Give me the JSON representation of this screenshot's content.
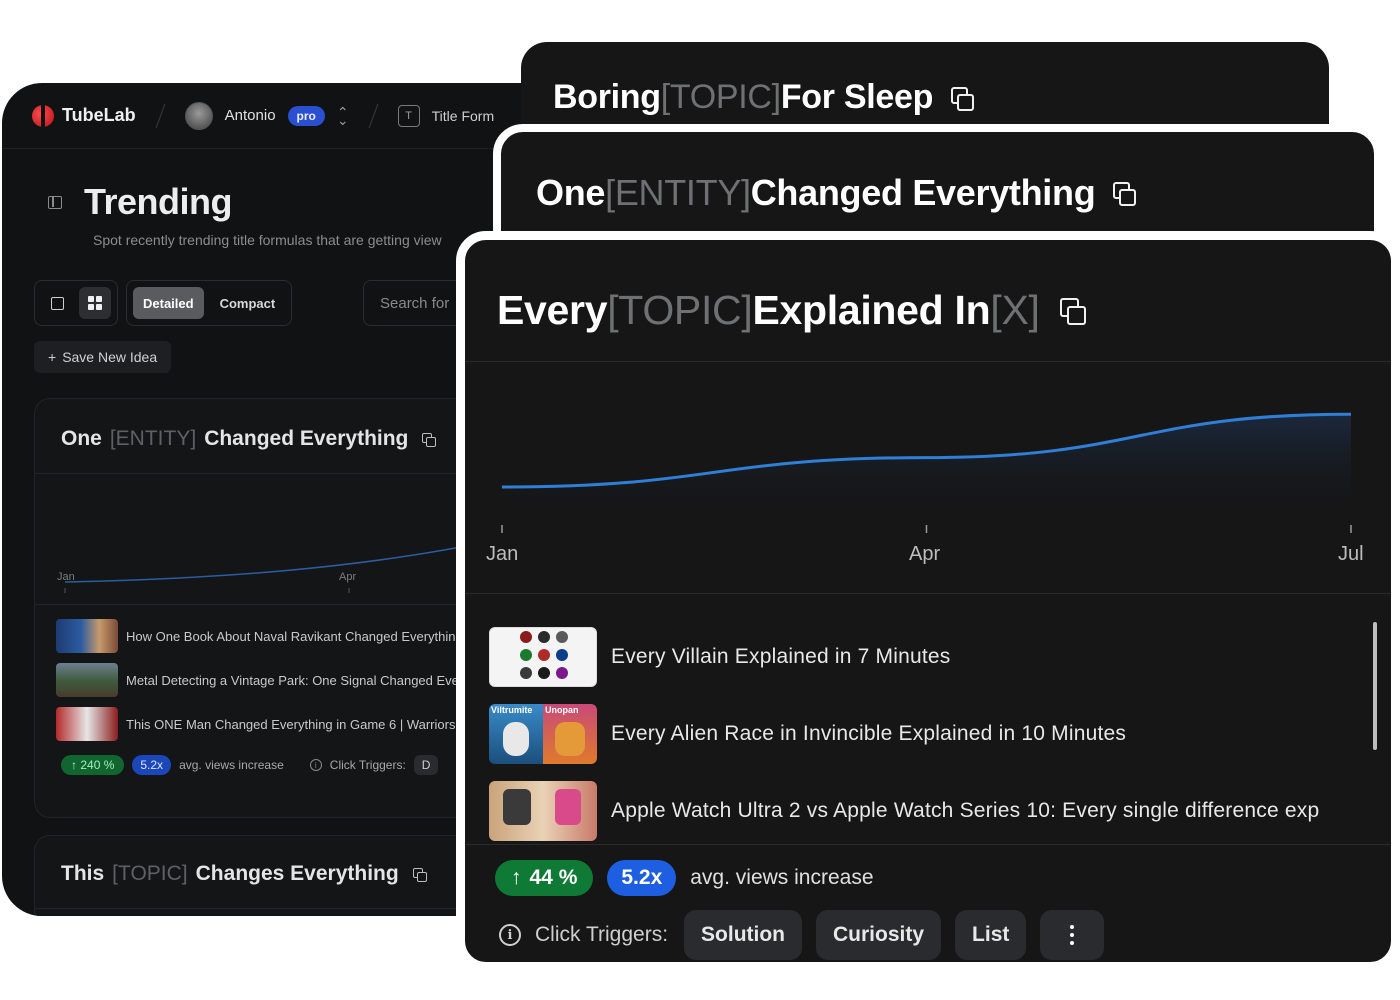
{
  "app": {
    "brand": "TubeLab",
    "user_name": "Antonio",
    "plan_badge": "pro",
    "section_label": "Title Form",
    "page_title": "Trending",
    "page_subtitle": "Spot recently trending title formulas that are getting view",
    "view_modes": [
      "Detailed",
      "Compact"
    ],
    "active_view_mode": "Detailed",
    "search_placeholder": "Search for",
    "save_idea_label": "Save New Idea",
    "card1": {
      "title_parts": [
        "One ",
        "[ENTITY]",
        " Changed Everything"
      ],
      "x_ticks": [
        "Jan",
        "Apr"
      ],
      "videos": [
        "How One Book About Naval Ravikant Changed Everythin",
        "Metal Detecting a Vintage Park: One Signal Changed Eve",
        "This ONE Man Changed Everything in Game 6 | Warriors"
      ],
      "growth": "240 %",
      "multiplier": "5.2x",
      "stat_text": "avg. views increase",
      "click_triggers_label": "Click Triggers:",
      "trigger_fragment": "D"
    },
    "card2": {
      "title_parts": [
        "This ",
        "[TOPIC]",
        " Changes Everything"
      ]
    }
  },
  "cards": {
    "back": {
      "title_parts": [
        "Boring ",
        "[TOPIC]",
        " For Sleep"
      ]
    },
    "middle": {
      "title_parts": [
        "One ",
        "[ENTITY]",
        " Changed Everything"
      ]
    },
    "front": {
      "title_parts": [
        "Every ",
        "[TOPIC]",
        " Explained In ",
        "[X]"
      ],
      "x_ticks": [
        "Jan",
        "Apr",
        "Jul"
      ],
      "videos": [
        "Every Villain Explained in 7 Minutes",
        "Every Alien Race in Invincible Explained in 10 Minutes",
        "Apple Watch Ultra 2 vs Apple Watch Series 10: Every single difference exp"
      ],
      "thumb2_labels": [
        "Viltrumite",
        "Unopan"
      ],
      "growth": "44 %",
      "multiplier": "5.2x",
      "stat_text": "avg. views increase",
      "click_triggers_label": "Click Triggers:",
      "triggers": [
        "Solution",
        "Curiosity",
        "List"
      ]
    }
  },
  "chart_data": {
    "type": "area",
    "x": [
      "Jan",
      "Apr",
      "Jul"
    ],
    "title": "",
    "xlabel": "",
    "ylabel": "",
    "grid": false,
    "series": [
      {
        "values": [
          0.2,
          0.41,
          0.72
        ]
      }
    ],
    "ylim": [
      0,
      1
    ],
    "colors": {
      "line": "#2f7fd6",
      "fill_top": "#1b2a40"
    }
  }
}
